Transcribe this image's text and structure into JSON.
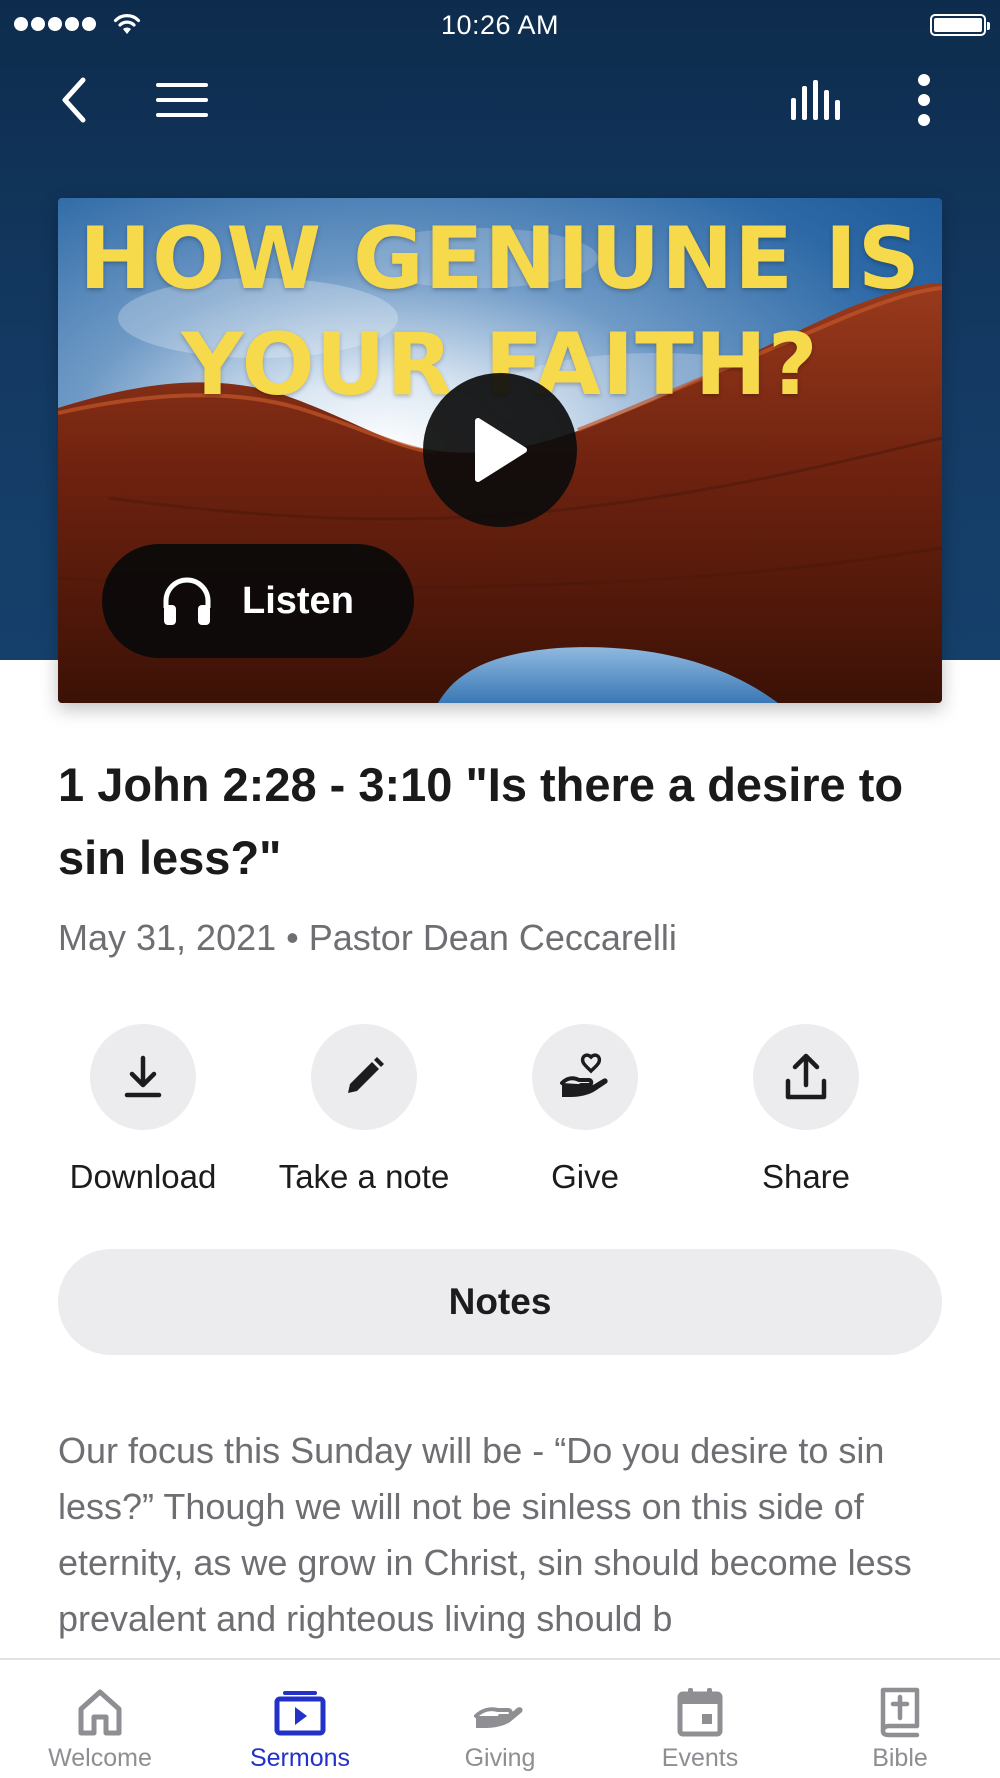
{
  "status_bar": {
    "time": "10:26 AM"
  },
  "nav": {
    "back_icon": "chevron-left-icon",
    "menu_icon": "hamburger-menu-icon",
    "audio_icon": "audio-bars-icon",
    "more_icon": "vertical-ellipsis-icon"
  },
  "hero": {
    "title_line1": "HOW GENIUNE IS",
    "title_line2": "YOUR FAITH?",
    "play_icon": "play-icon",
    "listen_label": "Listen",
    "colors": {
      "title": "#f7d94c",
      "header": "#0d2c4d"
    }
  },
  "sermon": {
    "title": "1 John 2:28 - 3:10   \"Is there a desire to sin less?\"",
    "date": "May 31, 2021",
    "separator": "•",
    "speaker": "Pastor Dean Ceccarelli"
  },
  "actions": [
    {
      "label": "Download",
      "icon": "download-icon"
    },
    {
      "label": "Take a note",
      "icon": "pencil-icon"
    },
    {
      "label": "Give",
      "icon": "hand-heart-icon"
    },
    {
      "label": "Share",
      "icon": "share-icon"
    }
  ],
  "notes_button": "Notes",
  "description": "Our focus this Sunday will be - “Do you desire to sin less?”  Though we will not be sinless on this side of eternity, as we grow in Christ, sin should become less prevalent and righteous living should b",
  "tabs": [
    {
      "label": "Welcome",
      "icon": "home-icon",
      "active": false
    },
    {
      "label": "Sermons",
      "icon": "video-play-icon",
      "active": true
    },
    {
      "label": "Giving",
      "icon": "giving-hand-icon",
      "active": false
    },
    {
      "label": "Events",
      "icon": "calendar-icon",
      "active": false
    },
    {
      "label": "Bible",
      "icon": "bible-icon",
      "active": false
    }
  ],
  "accent_color": "#2232c7"
}
